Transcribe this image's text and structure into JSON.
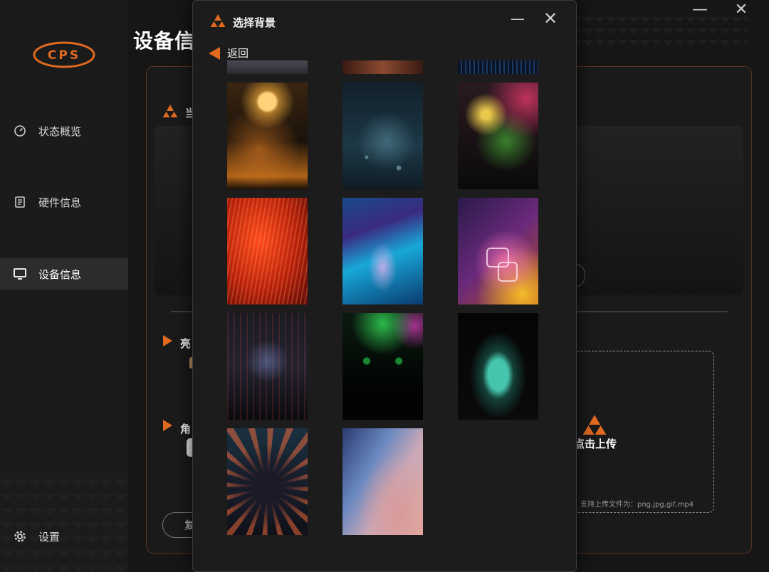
{
  "app": {
    "logo_text": "CPS",
    "page_title": "设备信息",
    "accent_color": "#e06a20",
    "nav": [
      {
        "label": "状态概览",
        "icon": "gauge-icon"
      },
      {
        "label": "硬件信息",
        "icon": "document-icon"
      },
      {
        "label": "设备信息",
        "icon": "monitor-icon",
        "active": true
      },
      {
        "label": "设置",
        "icon": "gear-icon"
      }
    ],
    "sections": {
      "current": "当",
      "brightness": "亮",
      "angle": "角"
    },
    "restore_button": "复",
    "upload": {
      "label": "点击上传",
      "hint": "支持上传文件为：png,jpg,gif,mp4"
    }
  },
  "dialog": {
    "title": "选择背景",
    "back_label": "返回",
    "minimize_glyph": "—",
    "close_glyph": "✕",
    "thumbnails": [
      {
        "name": "previous-row-1",
        "visible": "partial"
      },
      {
        "name": "previous-row-2",
        "visible": "partial"
      },
      {
        "name": "previous-row-3",
        "visible": "partial"
      },
      {
        "name": "moon-girl"
      },
      {
        "name": "teal-bokeh"
      },
      {
        "name": "neon-dots"
      },
      {
        "name": "red-wave"
      },
      {
        "name": "blue-wave"
      },
      {
        "name": "neon-squares"
      },
      {
        "name": "cyber-city"
      },
      {
        "name": "green-arch"
      },
      {
        "name": "glowing-mushroom"
      },
      {
        "name": "neon-tunnel"
      },
      {
        "name": "pastel-gradient"
      }
    ]
  }
}
